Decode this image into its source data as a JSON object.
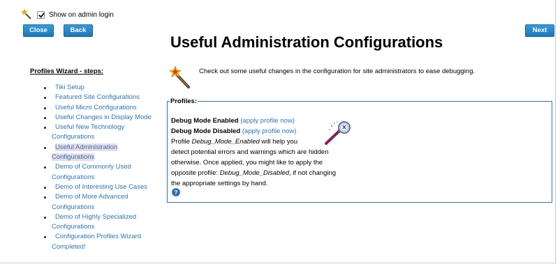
{
  "topbar": {
    "show_admin_login_label": "Show on admin login",
    "show_admin_login_checked": true
  },
  "buttons": {
    "close": "Close",
    "back": "Back",
    "next": "Next"
  },
  "page_title": "Useful Administration Configurations",
  "sidebar": {
    "title": "Profiles Wizard - steps:",
    "steps": [
      {
        "first": "Tiki Setup",
        "rest": "",
        "active": false
      },
      {
        "first": "Featured Site Configurations",
        "rest": "",
        "active": false
      },
      {
        "first": "Useful Micro Configurations",
        "rest": "",
        "active": false
      },
      {
        "first": "Useful Changes in Display Mode",
        "rest": "",
        "active": false
      },
      {
        "first": "Useful New Technology",
        "rest": "Configurations",
        "active": false
      },
      {
        "first": "Useful Administration",
        "rest": "Configurations",
        "active": true
      },
      {
        "first": "Demo of Commonly Used",
        "rest": "Configurations",
        "active": false
      },
      {
        "first": "Demo of Interesting Use Cases",
        "rest": "",
        "active": false
      },
      {
        "first": "Demo of More Advanced",
        "rest": "Configurations",
        "active": false
      },
      {
        "first": "Demo of Highly Specialized",
        "rest": "Configurations",
        "active": false
      },
      {
        "first": "Configuration Profiles Wizard",
        "rest": "Completed!",
        "active": false
      }
    ]
  },
  "intro_text": "Check out some useful changes in the configuration for site administrators to ease debugging.",
  "profiles": {
    "legend": "Profiles:",
    "debug_enabled_label": "Debug Mode Enabled",
    "debug_disabled_label": "Debug Mode Disabled",
    "apply_link_open": "(",
    "apply_link_text": "apply profile now",
    "apply_link_close": ")",
    "desc_1": "Profile ",
    "desc_1_em": "Debug_Mode_Enabled",
    "desc_1_rest": " will help you",
    "desc_2": "detect potential errors and warnings which are hidden",
    "desc_3": "otherwise. Once applied, you might like to apply the",
    "desc_4": "opposite profile: ",
    "desc_4_em": "Debug_Mode_Disabled",
    "desc_4_rest": ", if not changing",
    "desc_5": "the appropriate settings by hand."
  }
}
